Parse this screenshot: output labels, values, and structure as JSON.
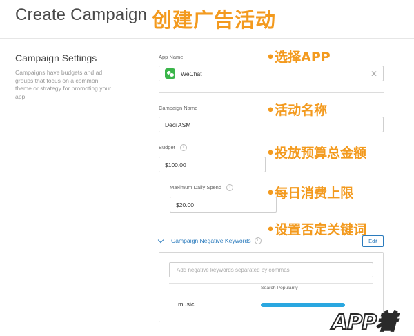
{
  "header": {
    "title": "Create Campaign",
    "annotation": "创建广告活动"
  },
  "settings": {
    "title": "Campaign Settings",
    "description": "Campaigns have budgets and ad groups that focus on a common theme or strategy for promoting your app."
  },
  "app_name": {
    "label": "App Name",
    "value": "WeChat",
    "annotation": "•选择APP"
  },
  "campaign_name": {
    "label": "Campaign Name",
    "value": "Deci ASM",
    "annotation": "•活动名称"
  },
  "budget": {
    "label": "Budget",
    "value": "$100.00",
    "annotation": "•投放预算总金额"
  },
  "daily_spend": {
    "label": "Maximum Daily Spend",
    "value": "$20.00",
    "annotation": "•每日消费上限"
  },
  "negative_keywords": {
    "title": "Campaign Negative Keywords",
    "edit_label": "Edit",
    "input_placeholder": "Add negative keywords separated by commas",
    "column_header": "Search Popularity",
    "annotation": "•设置否定关键词",
    "keywords": [
      {
        "text": "music",
        "popularity": 1.0
      }
    ]
  },
  "watermark": {
    "text": "APP着"
  },
  "colors": {
    "accent": "#2b7bbd",
    "annotation": "#f39a1e",
    "popularity_bar": "#2aa7e0",
    "app_icon": "#3ab54a"
  }
}
